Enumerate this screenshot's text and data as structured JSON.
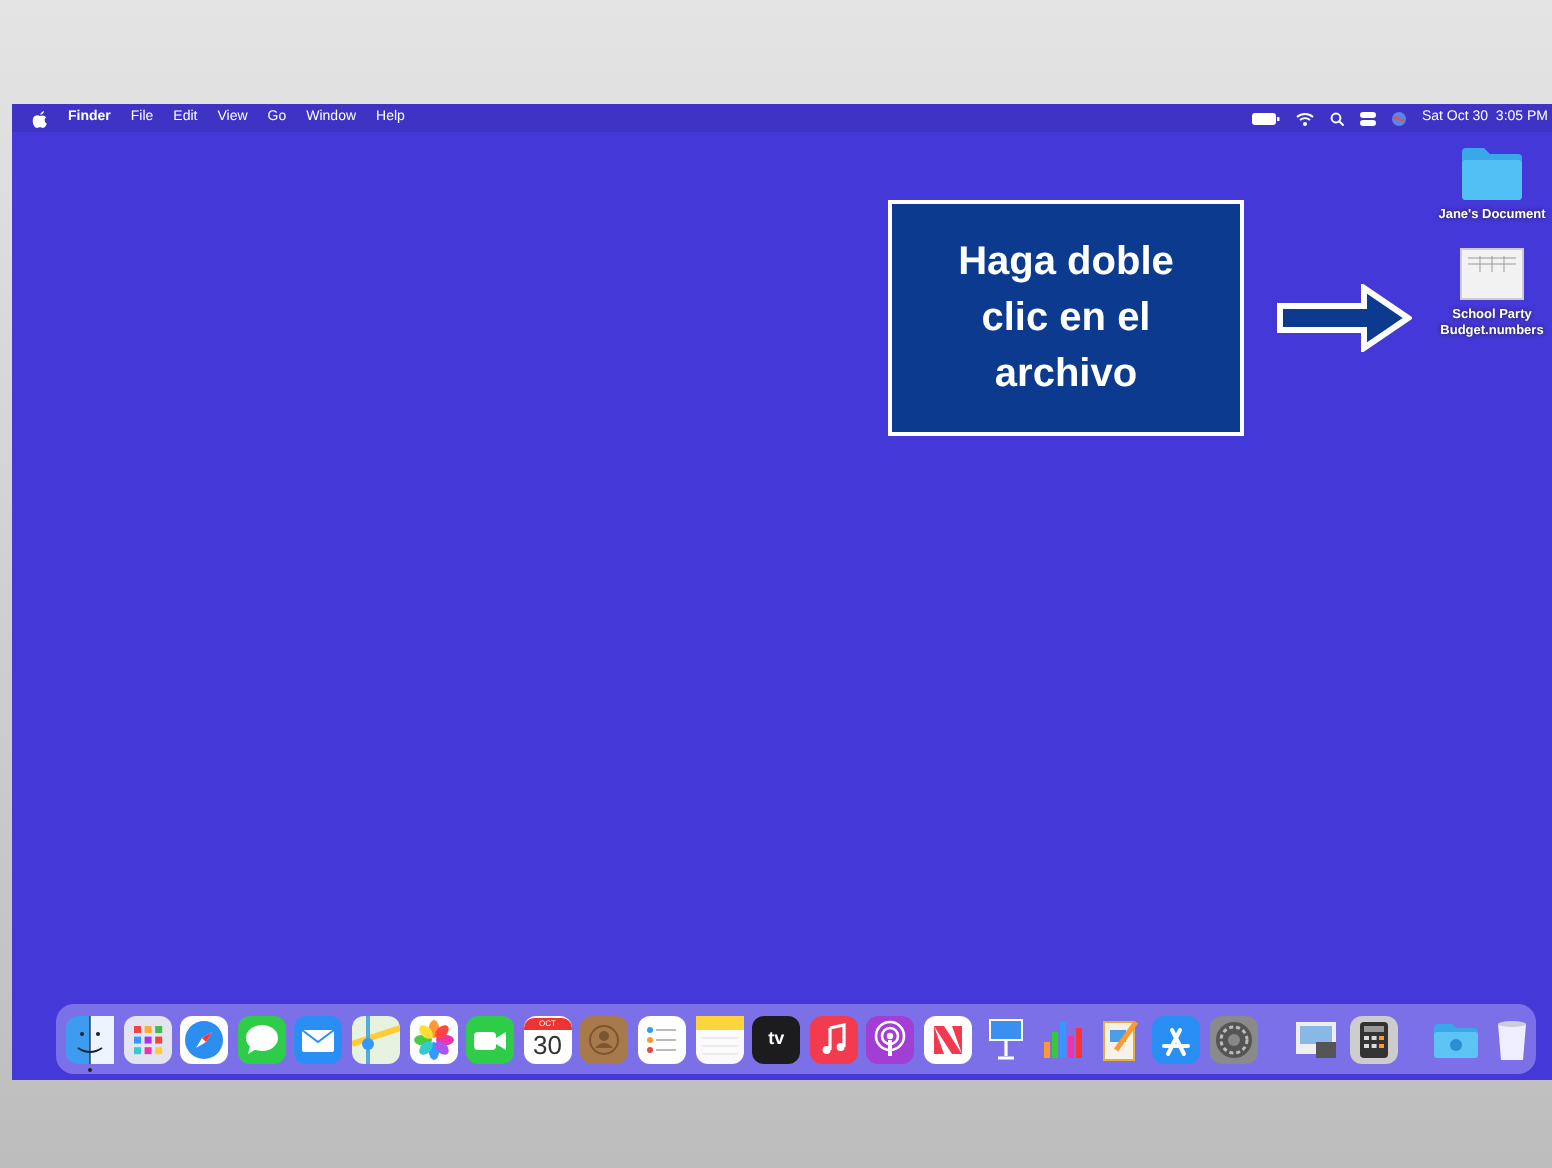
{
  "menu_bar": {
    "app_name": "Finder",
    "menus": [
      "File",
      "Edit",
      "View",
      "Go",
      "Window",
      "Help"
    ],
    "clock": "Sat Oct 30  3:05 PM"
  },
  "callout": {
    "text": "Haga doble clic en el archivo"
  },
  "desktop_icons": [
    {
      "kind": "folder",
      "label": "Jane's Document"
    },
    {
      "kind": "spreadsheet",
      "label": "School Party Budget.numbers"
    }
  ],
  "dock": [
    {
      "kind": "finder",
      "running": true
    },
    {
      "kind": "launchpad",
      "running": false
    },
    {
      "kind": "safari",
      "running": false
    },
    {
      "kind": "messages",
      "running": false
    },
    {
      "kind": "mail",
      "running": false
    },
    {
      "kind": "maps",
      "running": false
    },
    {
      "kind": "photos",
      "running": false
    },
    {
      "kind": "facetime",
      "running": false
    },
    {
      "kind": "calendar",
      "running": false,
      "month": "OCT",
      "day": "30"
    },
    {
      "kind": "contacts",
      "running": false
    },
    {
      "kind": "reminders",
      "running": false
    },
    {
      "kind": "notes",
      "running": false
    },
    {
      "kind": "tv",
      "running": false,
      "label": "tv"
    },
    {
      "kind": "music",
      "running": false
    },
    {
      "kind": "podcasts",
      "running": false
    },
    {
      "kind": "news",
      "running": false
    },
    {
      "kind": "keynote",
      "running": false
    },
    {
      "kind": "numbers",
      "running": false
    },
    {
      "kind": "pages",
      "running": false
    },
    {
      "kind": "appstore",
      "running": false
    },
    {
      "kind": "settings",
      "running": false
    },
    {
      "kind": "separator"
    },
    {
      "kind": "preview",
      "running": false
    },
    {
      "kind": "calculator",
      "running": false
    },
    {
      "kind": "separator"
    },
    {
      "kind": "downloads",
      "running": false
    },
    {
      "kind": "trash",
      "running": false
    }
  ]
}
